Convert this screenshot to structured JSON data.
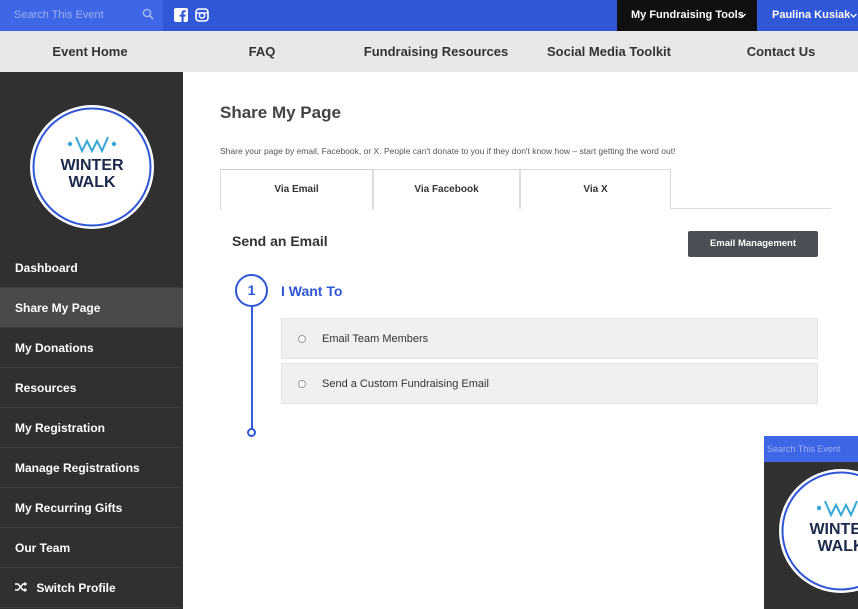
{
  "topbar": {
    "search_placeholder": "Search This Event",
    "tools_label": "My Fundraising Tools",
    "user_label": "Paulina Kusiak"
  },
  "nav": [
    "Event Home",
    "FAQ",
    "Fundraising Resources",
    "Social Media Toolkit",
    "Contact Us"
  ],
  "logo": {
    "line1": "WINTER",
    "line2": "WALK"
  },
  "sidebar": {
    "items": [
      "Dashboard",
      "Share My Page",
      "My Donations",
      "Resources",
      "My Registration",
      "Manage Registrations",
      "My Recurring Gifts",
      "Our Team",
      "Switch Profile"
    ],
    "active": "Share My Page"
  },
  "main": {
    "title": "Share My Page",
    "subtitle": "Share your page by email, Facebook, or X. People can't donate to you if they don't know how – start getting the word out!",
    "tabs": [
      "Via Email",
      "Via Facebook",
      "Via X"
    ],
    "active_tab": "Via Email",
    "section_title": "Send an Email",
    "email_button": "Email Management",
    "step_number": "1",
    "step_title": "I Want To",
    "options": [
      "Email Team Members",
      "Send a Custom Fundraising Email"
    ]
  },
  "overlay": {
    "search_placeholder": "Search This Event",
    "logo_line1": "WINTER",
    "logo_line2": "WALK"
  },
  "colors": {
    "brand_blue": "#2f57d8",
    "sidebar_bg": "#303030",
    "nav_bg": "#e8e8ea"
  }
}
